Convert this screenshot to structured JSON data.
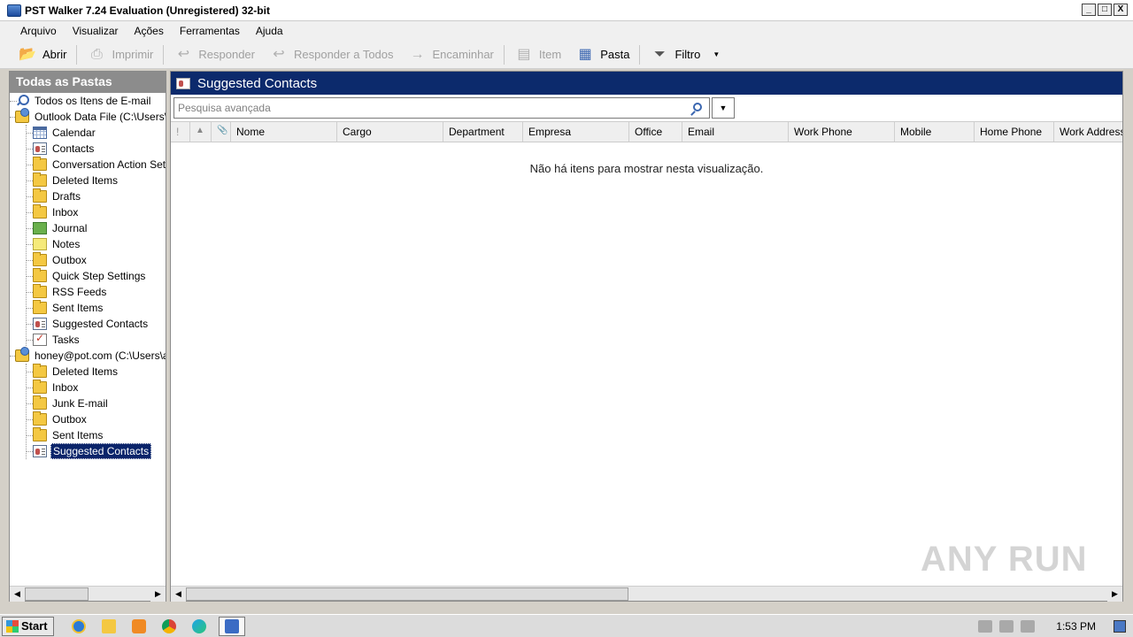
{
  "window": {
    "title": "PST Walker 7.24 Evaluation (Unregistered) 32-bit",
    "controls": [
      "_",
      "□",
      "X"
    ]
  },
  "menu": [
    "Arquivo",
    "Visualizar",
    "Ações",
    "Ferramentas",
    "Ajuda"
  ],
  "toolbar": {
    "open": "Abrir",
    "print": "Imprimir",
    "reply": "Responder",
    "reply_all": "Responder a Todos",
    "forward": "Encaminhar",
    "item": "Item",
    "folder": "Pasta",
    "filter": "Filtro"
  },
  "left_panel": {
    "header": "Todas as Pastas",
    "tree": [
      {
        "label": "Todos os Itens de E-mail",
        "level": 0,
        "icon": "search-icon"
      },
      {
        "label": "Outlook Data File (C:\\Users\\...\\",
        "level": 0,
        "icon": "data-file-icon"
      },
      {
        "label": "Calendar",
        "level": 1,
        "icon": "calendar-icon"
      },
      {
        "label": "Contacts",
        "level": 1,
        "icon": "contact-icon"
      },
      {
        "label": "Conversation Action Setting",
        "level": 1,
        "icon": "folder-icon"
      },
      {
        "label": "Deleted Items",
        "level": 1,
        "icon": "folder-icon"
      },
      {
        "label": "Drafts",
        "level": 1,
        "icon": "folder-icon"
      },
      {
        "label": "Inbox",
        "level": 1,
        "icon": "folder-icon"
      },
      {
        "label": "Journal",
        "level": 1,
        "icon": "journal-icon"
      },
      {
        "label": "Notes",
        "level": 1,
        "icon": "notes-icon"
      },
      {
        "label": "Outbox",
        "level": 1,
        "icon": "folder-icon"
      },
      {
        "label": "Quick Step Settings",
        "level": 1,
        "icon": "folder-icon"
      },
      {
        "label": "RSS Feeds",
        "level": 1,
        "icon": "folder-icon"
      },
      {
        "label": "Sent Items",
        "level": 1,
        "icon": "folder-icon"
      },
      {
        "label": "Suggested Contacts",
        "level": 1,
        "icon": "contact-icon"
      },
      {
        "label": "Tasks",
        "level": 1,
        "icon": "tasks-icon"
      },
      {
        "label": "honey@pot.com (C:\\Users\\adm",
        "level": 0,
        "icon": "data-file-icon"
      },
      {
        "label": "Deleted Items",
        "level": 1,
        "icon": "folder-icon"
      },
      {
        "label": "Inbox",
        "level": 1,
        "icon": "folder-icon"
      },
      {
        "label": "Junk E-mail",
        "level": 1,
        "icon": "folder-icon"
      },
      {
        "label": "Outbox",
        "level": 1,
        "icon": "folder-icon"
      },
      {
        "label": "Sent Items",
        "level": 1,
        "icon": "folder-icon"
      },
      {
        "label": "Suggested Contacts",
        "level": 1,
        "icon": "contact-icon",
        "selected": true
      }
    ]
  },
  "right_panel": {
    "title": "Suggested Contacts",
    "search_placeholder": "Pesquisa avançada",
    "columns": [
      "!",
      "▲",
      "📎",
      "Nome",
      "Cargo",
      "Department",
      "Empresa",
      "Office",
      "Email",
      "Work Phone",
      "Mobile",
      "Home Phone",
      "Work Address"
    ],
    "empty_message": "Não há itens para mostrar nesta visualização."
  },
  "watermark": "ANY RUN",
  "taskbar": {
    "start": "Start",
    "clock": "1:53 PM"
  }
}
